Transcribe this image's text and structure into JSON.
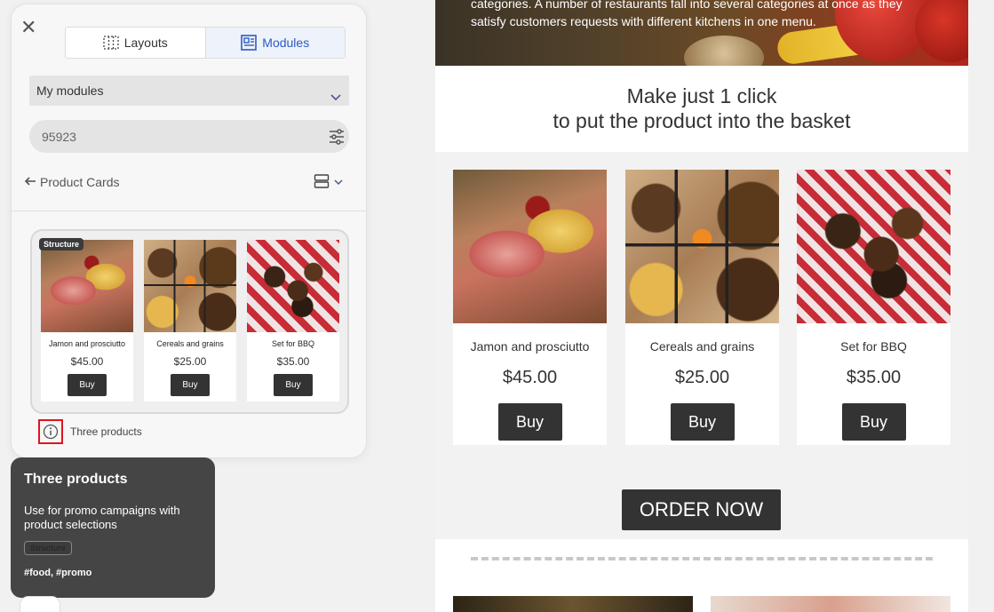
{
  "panel": {
    "tabs": [
      {
        "label": "Layouts",
        "icon": "layouts-grid-icon"
      },
      {
        "label": "Modules",
        "icon": "modules-icon",
        "active": true
      }
    ],
    "select": {
      "value": "My modules"
    },
    "search": {
      "value": "95923",
      "icon": "filter-sliders-icon"
    },
    "breadcrumb": {
      "label": "Product Cards",
      "icon": "arrow-left-icon"
    },
    "module": {
      "badge": "Structure",
      "products": [
        {
          "name": "Jamon and prosciutto",
          "price": "$45.00",
          "buy": "Buy"
        },
        {
          "name": "Cereals and grains",
          "price": "$25.00",
          "buy": "Buy"
        },
        {
          "name": "Set for BBQ",
          "price": "$35.00",
          "buy": "Buy"
        }
      ]
    },
    "info_label": "Three products"
  },
  "tooltip": {
    "title": "Three products",
    "description": "Use for promo campaigns with product selections",
    "badge": "Structure",
    "tags": "#food, #promo"
  },
  "email": {
    "hero_text": "categories. A number of restaurants fall into several categories at once as they satisfy customers requests with different kitchens in one menu.",
    "headline_line1": "Make just 1 click",
    "headline_line2": "to put the product into the basket",
    "products": [
      {
        "name": "Jamon and prosciutto",
        "price": "$45.00",
        "buy": "Buy"
      },
      {
        "name": "Cereals and grains",
        "price": "$25.00",
        "buy": "Buy"
      },
      {
        "name": "Set for BBQ",
        "price": "$35.00",
        "buy": "Buy"
      }
    ],
    "order_button": "ORDER NOW"
  },
  "colors": {
    "accent": "#2d5bc2",
    "button_dark": "#333333",
    "highlight": "#e0141c",
    "tooltip_bg": "#454545"
  }
}
